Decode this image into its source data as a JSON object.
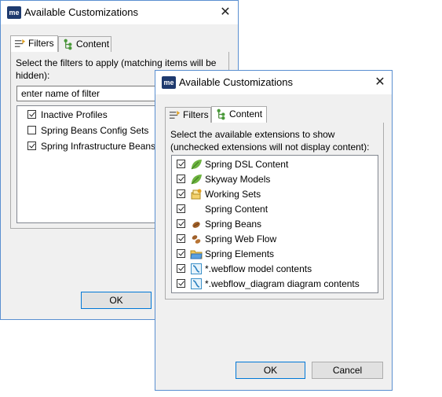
{
  "back_dialog": {
    "title": "Available Customizations",
    "app_icon_text": "me",
    "tabs": [
      {
        "label": "Filters",
        "icon": "filter-icon",
        "active": true
      },
      {
        "label": "Content",
        "icon": "content-tree-icon",
        "active": false
      }
    ],
    "description": "Select the filters to apply (matching items will be hidden):",
    "filter_input_value": "enter name of filter",
    "items": [
      {
        "label": "Inactive Profiles",
        "checked": true
      },
      {
        "label": "Spring Beans Config Sets",
        "checked": false
      },
      {
        "label": "Spring Infrastructure Beans",
        "checked": true
      }
    ],
    "ok_label": "OK"
  },
  "front_dialog": {
    "title": "Available Customizations",
    "app_icon_text": "me",
    "tabs": [
      {
        "label": "Filters",
        "icon": "filter-icon",
        "active": false
      },
      {
        "label": "Content",
        "icon": "content-tree-icon",
        "active": true
      }
    ],
    "description": "Select the available extensions to show (unchecked extensions will not display content):",
    "items": [
      {
        "label": "Spring DSL Content",
        "checked": true,
        "icon": "spring-leaf-icon"
      },
      {
        "label": "Skyway Models",
        "checked": true,
        "icon": "spring-leaf-icon"
      },
      {
        "label": "Working Sets",
        "checked": true,
        "icon": "working-sets-icon"
      },
      {
        "label": "Spring Content",
        "checked": true,
        "icon": ""
      },
      {
        "label": "Spring Beans",
        "checked": true,
        "icon": "bean-icon"
      },
      {
        "label": "Spring Web Flow",
        "checked": true,
        "icon": "web-flow-icon"
      },
      {
        "label": "Spring Elements",
        "checked": true,
        "icon": "folder-icon"
      },
      {
        "label": "*.webflow model contents",
        "checked": true,
        "icon": "webflow-file-icon"
      },
      {
        "label": "*.webflow_diagram diagram contents",
        "checked": true,
        "icon": "webflow-file-icon"
      }
    ],
    "ok_label": "OK",
    "cancel_label": "Cancel"
  }
}
